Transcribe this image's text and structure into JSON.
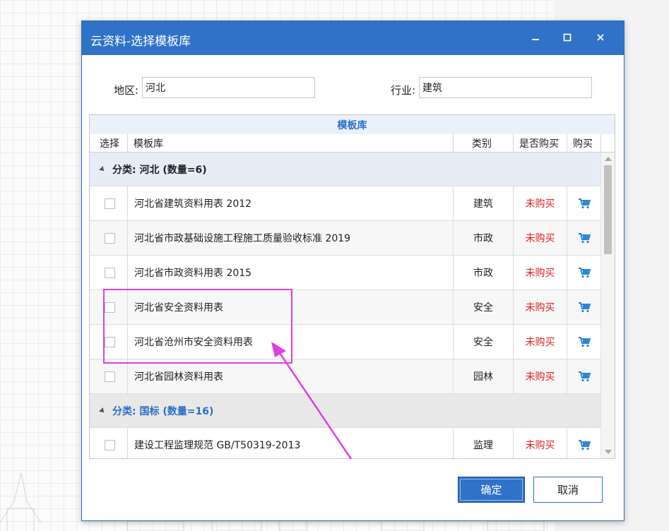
{
  "window": {
    "title": "云资料-选择模板库",
    "controls": [
      "minimize-icon",
      "maximize-icon",
      "close-icon"
    ]
  },
  "filters": {
    "region_label": "地区:",
    "region_value": "河北",
    "industry_label": "行业:",
    "industry_value": "建筑"
  },
  "grid": {
    "group_header": "模板库",
    "columns": [
      "选择",
      "模板库",
      "类别",
      "是否购买",
      "购买"
    ],
    "groups": [
      {
        "label": "分类: 河北 (数量=6)",
        "rows": [
          {
            "name": "河北省建筑资料用表 2012",
            "category": "建筑",
            "status": "未购买"
          },
          {
            "name": "河北省市政基础设施工程施工质量验收标准 2019",
            "category": "市政",
            "status": "未购买"
          },
          {
            "name": "河北省市政资料用表 2015",
            "category": "市政",
            "status": "未购买"
          },
          {
            "name": "河北省安全资料用表",
            "category": "安全",
            "status": "未购买"
          },
          {
            "name": "河北省沧州市安全资料用表",
            "category": "安全",
            "status": "未购买"
          },
          {
            "name": "河北省园林资料用表",
            "category": "园林",
            "status": "未购买"
          }
        ]
      },
      {
        "label": "分类: 国标 (数量=16)",
        "rows": [
          {
            "name": "建设工程监理规范 GB/T50319-2013",
            "category": "监理",
            "status": "未购买"
          }
        ]
      }
    ]
  },
  "buttons": {
    "ok": "确定",
    "cancel": "取消"
  },
  "colors": {
    "accent": "#2f72c8",
    "status_red": "#e02020",
    "annotation": "#e040e0",
    "group_link": "#2a6fc4"
  }
}
